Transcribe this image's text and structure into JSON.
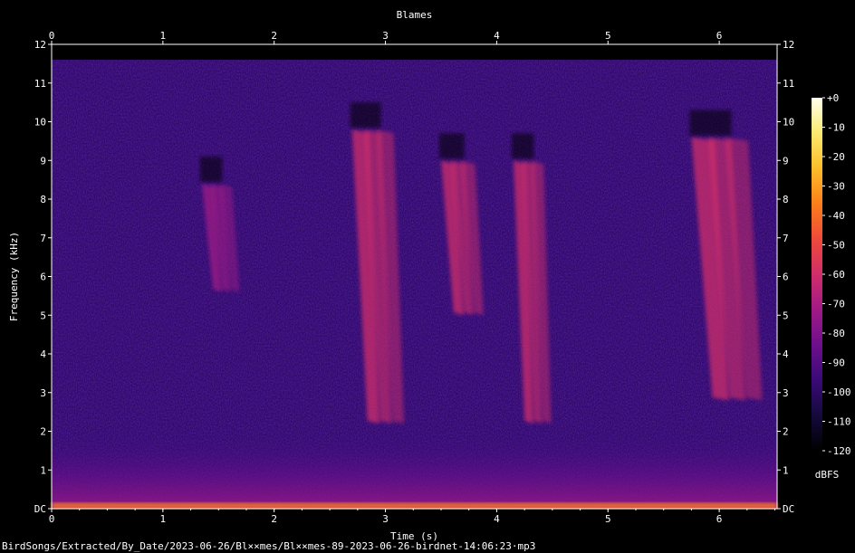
{
  "chart_data": {
    "type": "heatmap",
    "title": "Blames",
    "xlabel": "Time (s)",
    "ylabel": "Frequency (kHz)",
    "xlim": [
      0,
      6.52
    ],
    "ylim": [
      0,
      12
    ],
    "x_ticks": [
      "0",
      "1",
      "2",
      "3",
      "4",
      "5",
      "6"
    ],
    "y_ticks": [
      "DC",
      "1",
      "2",
      "3",
      "4",
      "5",
      "6",
      "7",
      "8",
      "9",
      "10",
      "11",
      "12"
    ],
    "colorbar": {
      "label": "dBFS",
      "range": [
        -120,
        0
      ],
      "ticks": [
        "+0",
        "-10",
        "-20",
        "-30",
        "-40",
        "-50",
        "-60",
        "-70",
        "-80",
        "-90",
        "-100",
        "-110",
        "-120"
      ],
      "colors": [
        "#000000",
        "#140a3c",
        "#3a0a78",
        "#6e0f8c",
        "#a01a86",
        "#d02e6a",
        "#ee4a3a",
        "#fb7f1a",
        "#fcbd2a",
        "#fbea6e",
        "#ffffee"
      ]
    },
    "background_level_dbfs": -100,
    "max_frequency_khz": 11.6,
    "calls": [
      {
        "t_start": 1.35,
        "t_end": 1.75,
        "f_high": 8.4,
        "f_low": 5.6,
        "level_dbfs": -68
      },
      {
        "t_start": 2.7,
        "t_end": 3.25,
        "f_high": 9.8,
        "f_low": 2.2,
        "level_dbfs": -55
      },
      {
        "t_start": 3.5,
        "t_end": 3.95,
        "f_high": 9.0,
        "f_low": 5.0,
        "level_dbfs": -62
      },
      {
        "t_start": 4.15,
        "t_end": 4.55,
        "f_high": 9.0,
        "f_low": 2.2,
        "level_dbfs": -65
      },
      {
        "t_start": 5.75,
        "t_end": 6.5,
        "f_high": 9.6,
        "f_low": 2.8,
        "level_dbfs": -58
      }
    ],
    "low_band": {
      "f_high": 2.0,
      "level_dbfs": -80,
      "dc_level_dbfs": -35
    }
  },
  "footer": {
    "path": "BirdSongs/Extracted/By_Date/2023-06-26/Bl××mes/Bl××mes-89-2023-06-26-birdnet-14:06:23·mp3"
  }
}
